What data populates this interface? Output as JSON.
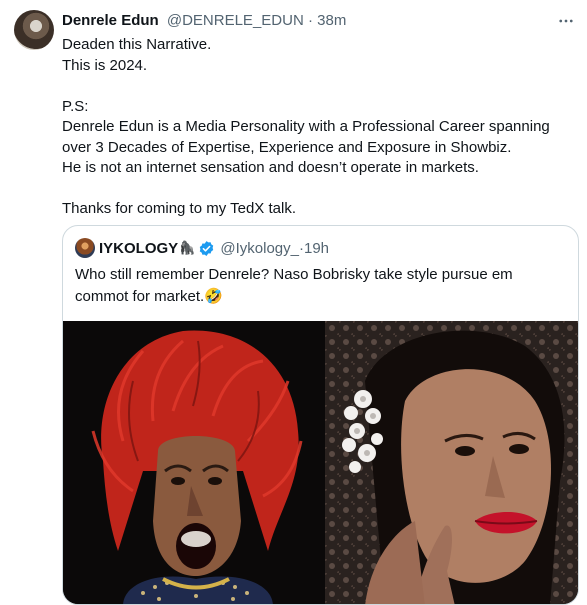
{
  "tweet": {
    "author_name": "Denrele Edun",
    "author_handle": "@DENRELE_EDUN",
    "separator": "·",
    "time": "38m",
    "lines": [
      "Deaden this Narrative.",
      "This is 2024.",
      "P.S:",
      "Denrele Edun is a Media Personality with a Professional Career spanning over 3 Decades of Expertise, Experience and Exposure in Showbiz.",
      "He is not an internet sensation and doesn’t operate in markets.",
      "Thanks for coming to my TedX talk."
    ]
  },
  "quote": {
    "author_name": "IYKOLOGY",
    "name_emoji": "🦍",
    "author_handle": "@Iykology_",
    "separator": "·",
    "time": "19h",
    "text": "Who still remember Denrele? Naso Bobrisky take style pursue em commot for market.🤣"
  },
  "colors": {
    "text": "#0f1419",
    "secondary": "#536471",
    "border": "#cfd9de",
    "verified": "#1d9bf0",
    "hair_red": "#c0251b"
  },
  "icons": [
    "more-icon",
    "verified-badge-icon"
  ]
}
